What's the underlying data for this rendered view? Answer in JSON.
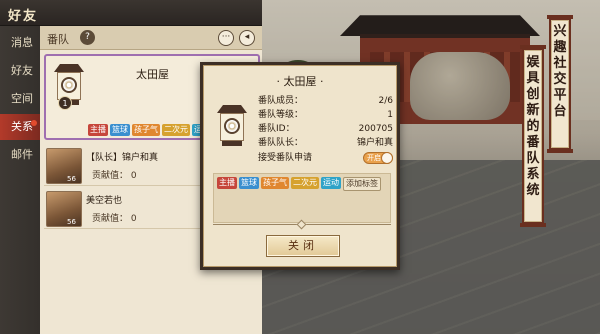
{
  "window": {
    "title": "好友"
  },
  "banners": {
    "right": [
      "兴",
      "趣",
      "社",
      "交",
      "平",
      "台"
    ],
    "left": [
      "娱",
      "具",
      "创",
      "新",
      "的",
      "番",
      "队",
      "系",
      "统"
    ]
  },
  "sidenav": {
    "items": [
      {
        "label": "消息"
      },
      {
        "label": "好友"
      },
      {
        "label": "空间"
      },
      {
        "label": "关系"
      },
      {
        "label": "邮件"
      }
    ]
  },
  "panel": {
    "header_label": "番队",
    "team": {
      "name": "太田屋",
      "level": "1",
      "tags": [
        "主播",
        "篮球",
        "孩子气",
        "二次元",
        "运动"
      ]
    },
    "members": [
      {
        "name": "【队长】锦户和真",
        "level": "56",
        "contrib_label": "贡献值：",
        "contrib_value": "0"
      },
      {
        "name": "美空若也",
        "level": "56",
        "contrib_label": "贡献值：",
        "contrib_value": "0"
      }
    ]
  },
  "dialog": {
    "title": "· 太田屋 ·",
    "rows": [
      {
        "k": "番队成员：",
        "v": "2/6"
      },
      {
        "k": "番队等级：",
        "v": "1"
      },
      {
        "k": "番队ID：",
        "v": "200705"
      },
      {
        "k": "番队队长：",
        "v": "锦户和真"
      }
    ],
    "apply_label": "接受番队申请",
    "apply_toggle_text": "开启",
    "apply_enabled": true,
    "tags": [
      "主播",
      "篮球",
      "孩子气",
      "二次元",
      "运动",
      "添加标签"
    ],
    "close_label": "关闭"
  },
  "colors": {
    "accent_red": "#b33a2a",
    "team_border": "#9f6fb0",
    "toggle_on": "#e9a14c"
  }
}
